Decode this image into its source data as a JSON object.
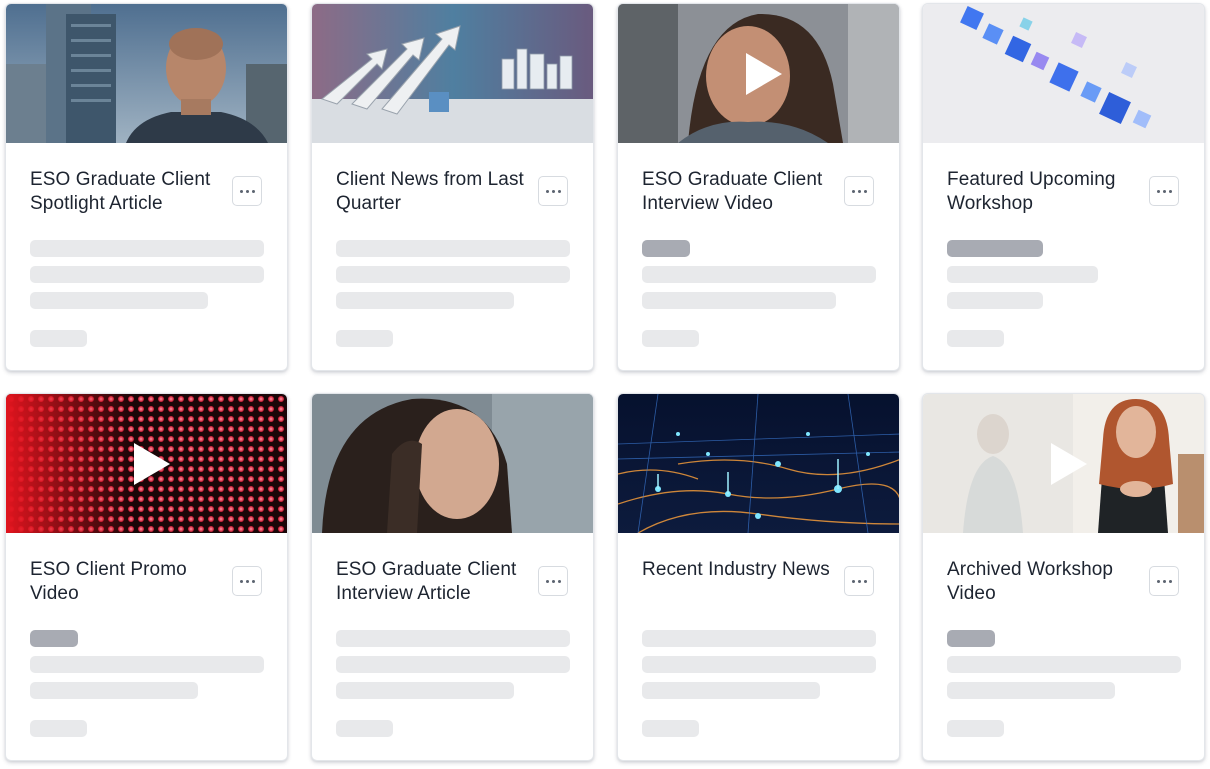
{
  "colors": {
    "skeleton": "#e8e9eb",
    "skeleton_badge": "#a8abb3",
    "border": "#d7dbe0"
  },
  "cards": [
    {
      "title": "ESO Graduate Client Spotlight Article",
      "image": "man-portrait-city-photo",
      "video": false
    },
    {
      "title": "Client News from Last Quarter",
      "image": "growth-arrows-city-photo",
      "video": false
    },
    {
      "title": "ESO Graduate Client Interview Video",
      "image": "young-person-portrait-photo",
      "video": true
    },
    {
      "title": "Featured Upcoming Workshop",
      "image": "abstract-blue-cubes-image",
      "video": false
    },
    {
      "title": "ESO Client Promo Video",
      "image": "red-led-lights-image",
      "video": true
    },
    {
      "title": "ESO Graduate Client Interview Article",
      "image": "woman-portrait-photo",
      "video": false
    },
    {
      "title": "Recent Industry News",
      "image": "network-map-lights-image",
      "video": false
    },
    {
      "title": "Archived Workshop Video",
      "image": "woman-whiteboard-photo",
      "video": true
    }
  ],
  "icons": {
    "more": "ellipsis-icon",
    "play": "play-icon"
  }
}
